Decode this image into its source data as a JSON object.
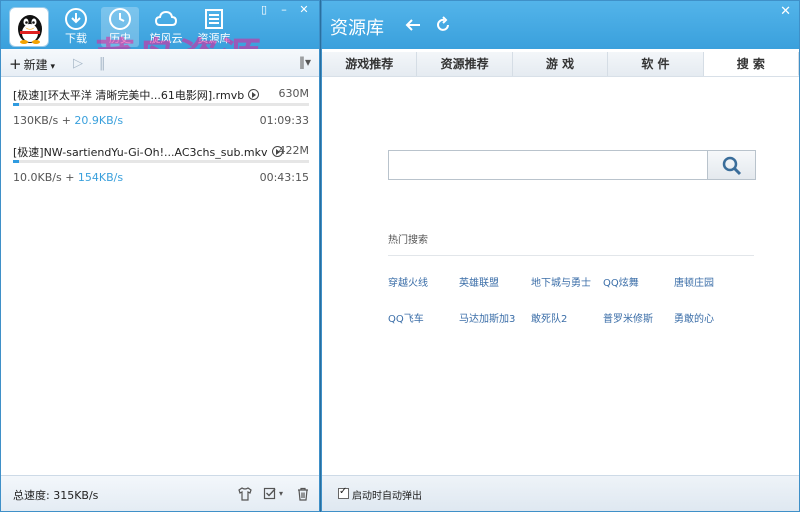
{
  "watermark": "菜鸟资源",
  "left": {
    "nav": [
      {
        "label": "下载",
        "icon": "download-icon"
      },
      {
        "label": "历史",
        "icon": "history-icon"
      },
      {
        "label": "旋风云",
        "icon": "cloud-icon"
      },
      {
        "label": "资源库",
        "icon": "library-icon"
      }
    ],
    "toolbar": {
      "new_label": "新建",
      "more_label": "‖▾"
    },
    "downloads": [
      {
        "name": "[极速][环太平洋 清晰完美中...61电影网].rmvb",
        "size": "630M",
        "speed": "130KB/s",
        "plus": " + ",
        "up_speed": "20.9KB/s",
        "time": "01:09:33",
        "progress": 0.02
      },
      {
        "name": "[极速]NW-sartiendYu-Gi-Oh!...AC3chs_sub.mkv",
        "size": "422M",
        "speed": "10.0KB/s",
        "plus": " + ",
        "up_speed": "154KB/s",
        "time": "00:43:15",
        "progress": 0.01
      }
    ],
    "status": {
      "total_speed": "总速度: 315KB/s"
    }
  },
  "right": {
    "title": "资源库",
    "tabs": [
      {
        "label": "游戏推荐"
      },
      {
        "label": "资源推荐"
      },
      {
        "label": "游 戏"
      },
      {
        "label": "软 件"
      },
      {
        "label": "搜 索"
      }
    ],
    "search": {
      "placeholder": ""
    },
    "hot_label": "热门搜索",
    "hot_rows": [
      [
        "穿越火线",
        "英雄联盟",
        "地下城与勇士",
        "QQ炫舞",
        "唐顿庄园"
      ],
      [
        "QQ飞车",
        "马达加斯加3",
        "敢死队2",
        "普罗米修斯",
        "勇敢的心"
      ]
    ],
    "status": {
      "auto_popup_label": "启动时自动弹出"
    }
  },
  "colors": {
    "accent": "#3aa0dc",
    "link": "#3b6ea8",
    "watermark": "#e6209a"
  }
}
